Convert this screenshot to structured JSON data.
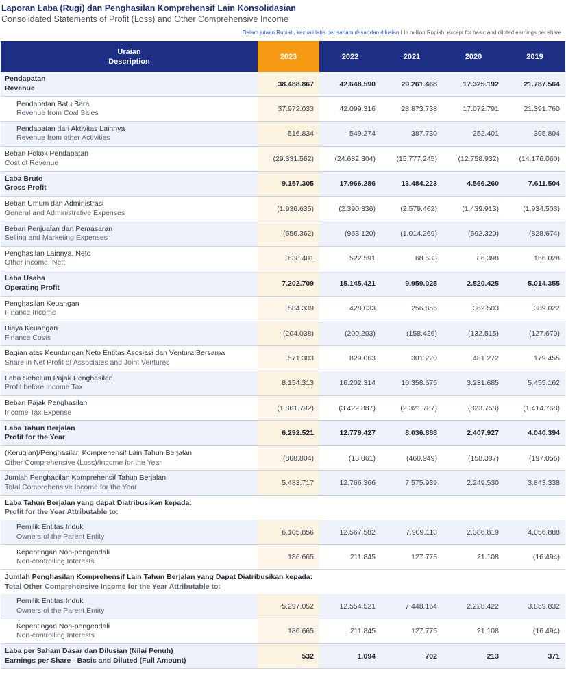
{
  "header": {
    "title_id": "Laporan Laba (Rugi) dan Penghasilan Komprehensif Lain Konsolidasian",
    "title_en": "Consolidated Statements of Profit (Loss) and Other Comprehensive Income",
    "note_id": "Dalam jutaan Rupiah, kecuali laba per saham dasar dan dilusian",
    "note_en": " I In million Rupiah, except for basic and diluted earnings per share"
  },
  "table": {
    "desc_label_id": "Uraian",
    "desc_label_en": "Description",
    "years": [
      "2023",
      "2022",
      "2021",
      "2020",
      "2019"
    ],
    "rows": [
      {
        "id": "Pendapatan",
        "en": "Revenue",
        "bold": true,
        "indent": false,
        "alt": true,
        "v": [
          "38.488.867",
          "42.648.590",
          "29.261.468",
          "17.325.192",
          "21.787.564"
        ]
      },
      {
        "id": "Pendapatan Batu Bara",
        "en": "Revenue from Coal Sales",
        "bold": false,
        "indent": true,
        "alt": false,
        "v": [
          "37.972.033",
          "42.099.316",
          "28.873.738",
          "17.072.791",
          "21.391.760"
        ]
      },
      {
        "id": "Pendapatan dari Aktivitas Lainnya",
        "en": "Revenue from other Activities",
        "bold": false,
        "indent": true,
        "alt": true,
        "v": [
          "516.834",
          "549.274",
          "387.730",
          "252.401",
          "395.804"
        ]
      },
      {
        "id": "Beban Pokok Pendapatan",
        "en": "Cost of Revenue",
        "bold": false,
        "indent": false,
        "alt": false,
        "v": [
          "(29.331.562)",
          "(24.682.304)",
          "(15.777.245)",
          "(12.758.932)",
          "(14.176.060)"
        ]
      },
      {
        "id": "Laba Bruto",
        "en": "Gross Profit",
        "bold": true,
        "indent": false,
        "alt": true,
        "v": [
          "9.157.305",
          "17.966.286",
          "13.484.223",
          "4.566.260",
          "7.611.504"
        ]
      },
      {
        "id": "Beban Umum dan Administrasi",
        "en": "General and Administrative Expenses",
        "bold": false,
        "indent": false,
        "alt": false,
        "v": [
          "(1.936.635)",
          "(2.390.336)",
          "(2.579.462)",
          "(1.439.913)",
          "(1.934.503)"
        ]
      },
      {
        "id": "Beban Penjualan dan Pemasaran",
        "en": "Selling and Marketing Expenses",
        "bold": false,
        "indent": false,
        "alt": true,
        "v": [
          "(656.362)",
          "(953.120)",
          "(1.014.269)",
          "(692.320)",
          "(828.674)"
        ]
      },
      {
        "id": "Penghasilan Lainnya, Neto",
        "en": "Other income, Nett",
        "bold": false,
        "indent": false,
        "alt": false,
        "v": [
          "638.401",
          "522.591",
          "68.533",
          "86.398",
          "166.028"
        ]
      },
      {
        "id": "Laba Usaha",
        "en": "Operating Profit",
        "bold": true,
        "indent": false,
        "alt": true,
        "v": [
          "7.202.709",
          "15.145.421",
          "9.959.025",
          "2.520.425",
          "5.014.355"
        ]
      },
      {
        "id": "Penghasilan Keuangan",
        "en": "Finance Income",
        "bold": false,
        "indent": false,
        "alt": false,
        "v": [
          "584.339",
          "428.033",
          "256.856",
          "362.503",
          "389.022"
        ]
      },
      {
        "id": "Biaya Keuangan",
        "en": "Finance Costs",
        "bold": false,
        "indent": false,
        "alt": true,
        "v": [
          "(204.038)",
          "(200.203)",
          "(158.426)",
          "(132.515)",
          "(127.670)"
        ]
      },
      {
        "id": "Bagian atas Keuntungan Neto Entitas Asosiasi dan Ventura Bersama",
        "en": "Share in Net Profit of Associates and Joint Ventures",
        "bold": false,
        "indent": false,
        "alt": false,
        "v": [
          "571.303",
          "829.063",
          "301.220",
          "481.272",
          "179.455"
        ]
      },
      {
        "id": "Laba Sebelum Pajak Penghasilan",
        "en": "Profit before Income Tax",
        "bold": false,
        "indent": false,
        "alt": true,
        "v": [
          "8.154.313",
          "16.202.314",
          "10.358.675",
          "3.231.685",
          "5.455.162"
        ]
      },
      {
        "id": "Beban Pajak Penghasilan",
        "en": "Income Tax Expense",
        "bold": false,
        "indent": false,
        "alt": false,
        "v": [
          "(1.861.792)",
          "(3.422.887)",
          "(2.321.787)",
          "(823.758)",
          "(1.414.768)"
        ]
      },
      {
        "id": "Laba Tahun Berjalan",
        "en": "Profit for the Year",
        "bold": true,
        "indent": false,
        "alt": true,
        "v": [
          "6.292.521",
          "12.779.427",
          "8.036.888",
          "2.407.927",
          "4.040.394"
        ]
      },
      {
        "id": "(Kerugian)/Penghasilan Komprehensif Lain Tahun Berjalan",
        "en": "Other Comprehensive (Loss)/Income for the Year",
        "bold": false,
        "indent": false,
        "alt": false,
        "v": [
          "(808.804)",
          "(13.061)",
          "(460.949)",
          "(158.397)",
          "(197.056)"
        ]
      },
      {
        "id": "Jumlah Penghasilan Komprehensif Tahun Berjalan",
        "en": "Total Comprehensive Income for the Year",
        "bold": false,
        "indent": false,
        "alt": true,
        "v": [
          "5.483.717",
          "12.766.366",
          "7.575.939",
          "2.249.530",
          "3.843.338"
        ]
      },
      {
        "section": true,
        "id": "Laba Tahun Berjalan yang dapat Diatribusikan kepada:",
        "en": "Profit for the Year Attributable to:"
      },
      {
        "id": "Pemilik Entitas Induk",
        "en": "Owners of the Parent Entity",
        "bold": false,
        "indent": true,
        "alt": true,
        "v": [
          "6.105.856",
          "12.567.582",
          "7.909.113",
          "2.386.819",
          "4.056.888"
        ]
      },
      {
        "id": "Kepentingan Non-pengendali",
        "en": "Non-controlling Interests",
        "bold": false,
        "indent": true,
        "alt": false,
        "v": [
          "186.665",
          "211.845",
          "127.775",
          "21.108",
          "(16.494)"
        ]
      },
      {
        "section": true,
        "id": "Jumlah Penghasilan Komprehensif Lain Tahun Berjalan yang Dapat Diatribusikan kepada:",
        "en": "Total Other Comprehensive Income for the Year Attributable to:"
      },
      {
        "id": "Pemilik Entitas Induk",
        "en": "Owners of the Parent Entity",
        "bold": false,
        "indent": true,
        "alt": true,
        "v": [
          "5.297.052",
          "12.554.521",
          "7.448.164",
          "2.228.422",
          "3.859.832"
        ]
      },
      {
        "id": "Kepentingan Non-pengendali",
        "en": "Non-controlling Interests",
        "bold": false,
        "indent": true,
        "alt": false,
        "v": [
          "186.665",
          "211.845",
          "127.775",
          "21.108",
          "(16.494)"
        ]
      },
      {
        "id": "Laba per Saham Dasar dan Dilusian (Nilai Penuh)",
        "en": "Earnings per Share - Basic and Diluted (Full Amount)",
        "bold": true,
        "indent": false,
        "alt": true,
        "v": [
          "532",
          "1.094",
          "702",
          "213",
          "371"
        ]
      }
    ]
  }
}
